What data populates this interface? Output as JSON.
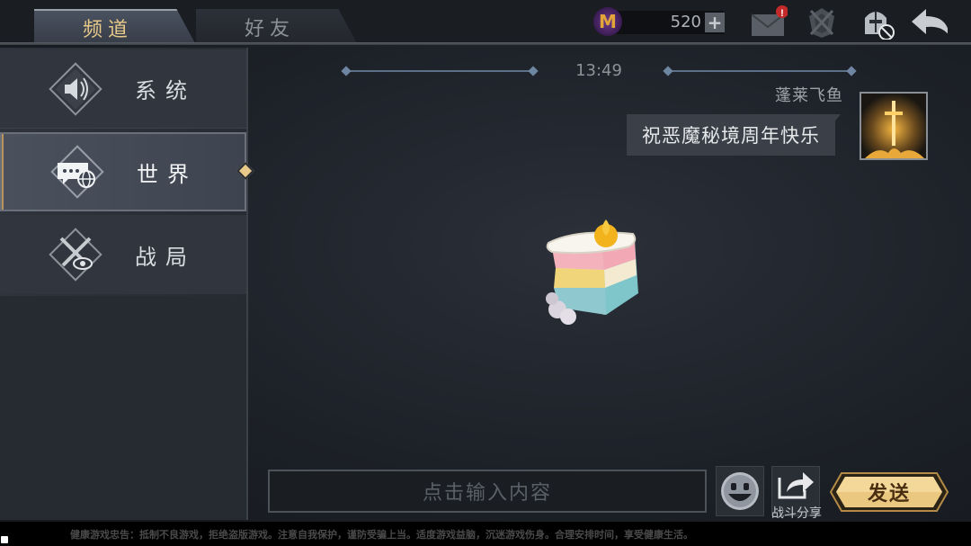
{
  "tabs": [
    {
      "label": "频道",
      "active": true
    },
    {
      "label": "好友",
      "active": false
    }
  ],
  "currency": {
    "icon": "m-coin-icon",
    "value": "520"
  },
  "top_icons": [
    "mail-icon",
    "guild-icon",
    "knight-helmet-muted-icon",
    "back-arrow-icon"
  ],
  "mail_badge": "!",
  "sidebar": {
    "items": [
      {
        "label": "系统",
        "icon": "speaker-icon",
        "selected": false
      },
      {
        "label": "世界",
        "icon": "globe-chat-icon",
        "selected": true
      },
      {
        "label": "战局",
        "icon": "crossed-swords-eye-icon",
        "selected": false
      }
    ]
  },
  "chat": {
    "time": "13:49",
    "message": {
      "sender": "蓬莱飞鱼",
      "text": "祝恶魔秘境周年快乐",
      "avatar": "sword-avatar"
    },
    "sticker": "cake-slice-sticker"
  },
  "input": {
    "placeholder": "点击输入内容"
  },
  "buttons": {
    "emoji": "emoji-icon",
    "share_label": "战斗分享",
    "send_label": "发送"
  },
  "notice": "健康游戏忠告：抵制不良游戏，拒绝盗版游戏。注意自我保护，谨防受骗上当。适度游戏益脑，沉迷游戏伤身。合理安排时间，享受健康生活。",
  "colors": {
    "accent_gold": "#e8c98a",
    "tab_inactive_text": "#8c9098",
    "bubble_bg": "#3a3f48",
    "send_button": "#e9c47d"
  }
}
